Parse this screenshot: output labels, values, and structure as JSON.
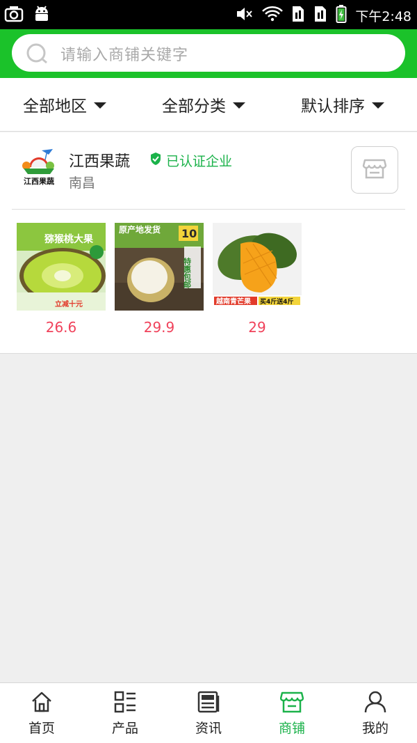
{
  "statusbar": {
    "time": "下午2:48",
    "icons": [
      "screenshot-icon",
      "android-icon",
      "mute-icon",
      "wifi-icon",
      "sim1-icon",
      "sim2-icon",
      "battery-icon"
    ]
  },
  "search": {
    "placeholder": "请输入商铺关键字",
    "icon": "search-icon"
  },
  "filters": [
    {
      "label": "全部地区"
    },
    {
      "label": "全部分类"
    },
    {
      "label": "默认排序"
    }
  ],
  "store": {
    "name": "江西果蔬",
    "verified_label": "已认证企业",
    "city": "南昌",
    "logo_text": "江西果蔬",
    "products": [
      {
        "price": "26.6",
        "banner": "猕猴桃大果",
        "subtext": "立减十元"
      },
      {
        "price": "29.9",
        "banner": "原产地发货",
        "badge": "10",
        "subtext": "特惠包邮"
      },
      {
        "price": "29",
        "banner": "越南青芒果",
        "subtext": "买4斤送4斤"
      }
    ]
  },
  "nav": {
    "items": [
      {
        "label": "首页",
        "icon": "home-icon"
      },
      {
        "label": "产品",
        "icon": "product-list-icon"
      },
      {
        "label": "资讯",
        "icon": "news-icon"
      },
      {
        "label": "商铺",
        "icon": "store-icon"
      },
      {
        "label": "我的",
        "icon": "user-icon"
      }
    ],
    "active_index": 3
  },
  "colors": {
    "brand_green": "#1bc22a",
    "price_red": "#f0425b",
    "verified_green": "#1bb24a"
  }
}
